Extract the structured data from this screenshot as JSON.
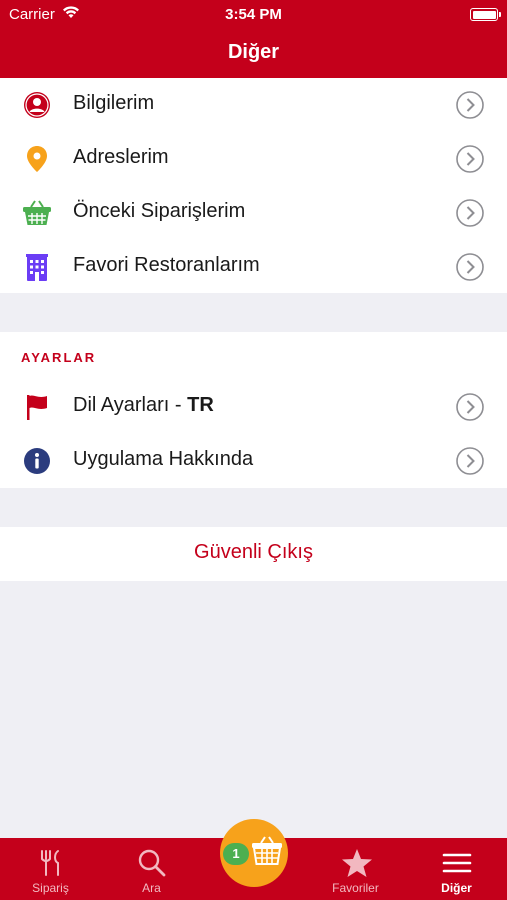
{
  "status_bar": {
    "carrier": "Carrier",
    "time": "3:54 PM"
  },
  "nav": {
    "title": "Diğer"
  },
  "menu": [
    {
      "label": "Bilgilerim",
      "icon": "user-icon",
      "color": "#c4001b"
    },
    {
      "label": "Adreslerim",
      "icon": "location-pin-icon",
      "color": "#f7a21b"
    },
    {
      "label": "Önceki Siparişlerim",
      "icon": "basket-icon",
      "color": "#4caf50"
    },
    {
      "label": "Favori Restoranlarım",
      "icon": "building-icon",
      "color": "#6b3df5"
    }
  ],
  "settings": {
    "header": "AYARLAR",
    "language_label": "Dil Ayarları - ",
    "language_value": "TR",
    "about_label": "Uygulama Hakkında"
  },
  "logout": {
    "label": "Güvenli Çıkış"
  },
  "tabs": [
    {
      "label": "Sipariş",
      "icon": "fork-knife-icon"
    },
    {
      "label": "Ara",
      "icon": "search-icon"
    },
    {
      "label": "Favoriler",
      "icon": "star-icon"
    },
    {
      "label": "Diğer",
      "icon": "menu-icon",
      "active": true
    }
  ],
  "basket": {
    "count": "1"
  },
  "colors": {
    "brand_red": "#c4001b",
    "basket_orange": "#f7a21b",
    "badge_green": "#4caf50"
  }
}
